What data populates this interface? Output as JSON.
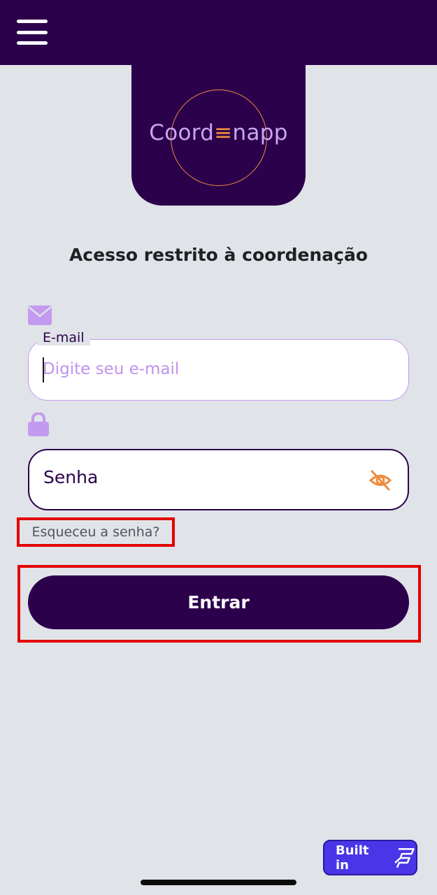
{
  "header": {
    "menu_icon": "hamburger-menu-icon"
  },
  "logo": {
    "text_before": "Coord",
    "text_mid": "≡",
    "text_after": "napp"
  },
  "heading": "Acesso restrito à coordenação",
  "email": {
    "icon": "envelope-icon",
    "label": "E-mail",
    "placeholder": "Digite seu e-mail",
    "value": ""
  },
  "senha": {
    "icon": "lock-icon",
    "placeholder": "Senha",
    "toggle_icon": "eye-off-icon"
  },
  "forgot_link": "Esqueceu a senha?",
  "submit_label": "Entrar",
  "badge": {
    "label": "Built in",
    "icon": "flutterflow-icon"
  },
  "colors": {
    "primary": "#2c014b",
    "accent": "#ee8c3d",
    "lavender": "#c39af0",
    "background": "#e0e3e8",
    "highlight": "#e30000",
    "badge": "#4a35e8"
  }
}
